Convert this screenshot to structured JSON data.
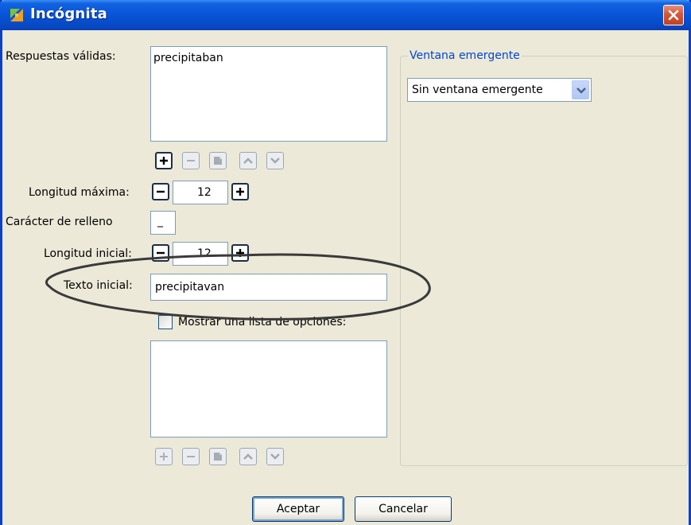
{
  "window": {
    "title": "Incógnita"
  },
  "form": {
    "respuestas_label": "Respuestas válidas:",
    "respuestas_items": [
      "precipitaban"
    ],
    "longitud_maxima_label": "Longitud máxima:",
    "longitud_maxima_value": "12",
    "caracter_relleno_label": "Carácter de relleno",
    "caracter_relleno_value": "_",
    "longitud_inicial_label": "Longitud inicial:",
    "longitud_inicial_value": "12",
    "texto_inicial_label": "Texto inicial:",
    "texto_inicial_value": "precipitavan",
    "mostrar_lista_label": "Mostrar una lista de opciones:",
    "mostrar_lista_checked": false
  },
  "popup": {
    "group_title": "Ventana emergente",
    "selected": "Sin ventana emergente"
  },
  "buttons": {
    "accept": "Aceptar",
    "cancel": "Cancelar"
  },
  "icons": {
    "title": "app-logo-icon",
    "close": "close-icon",
    "add": "plus-icon",
    "remove": "minus-icon",
    "edit": "edit-icon",
    "up": "chevron-up-icon",
    "down": "chevron-down-icon"
  },
  "colors": {
    "titlebar": "#0a55d9",
    "window_bg": "#ece9d8",
    "close_button": "#d45738",
    "group_title": "#0046d5"
  }
}
